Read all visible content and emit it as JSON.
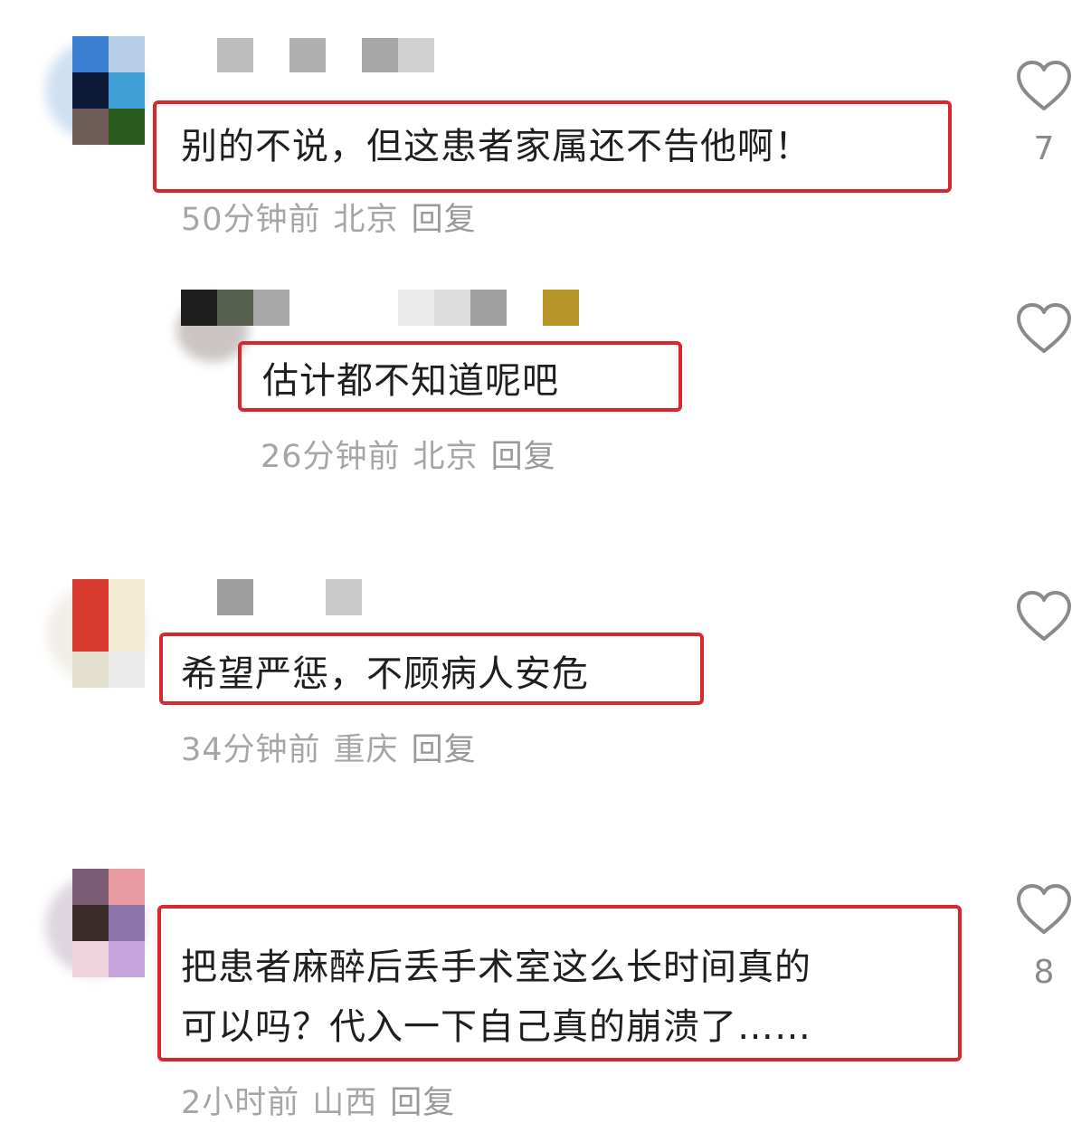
{
  "comments": [
    {
      "text": "别的不说，但这患者家属还不告他啊！",
      "time": "50分钟前",
      "location": "北京",
      "reply_label": "回复",
      "likes": "7",
      "avatar_colors": [
        "#3a7fd0",
        "#b6cfe6",
        "#0c1a36",
        "#3f9fd6",
        "#6e5a57",
        "#2b5a1e"
      ],
      "name_colors": [
        "#bdbdbd",
        "#b0b0b0",
        "#a7a7a7",
        "#d0d0d0"
      ]
    },
    {
      "text": "估计都不知道呢吧",
      "time": "26分钟前",
      "location": "北京",
      "reply_label": "回复",
      "likes": "",
      "avatar_colors": [
        "#1f1f1f",
        "#586050",
        "#a8a8a8"
      ],
      "name_colors": [
        "#ebebeb",
        "#dcdcdc",
        "#a0a0a0",
        "#b89528"
      ]
    },
    {
      "text": "希望严惩，不顾病人安危",
      "time": "34分钟前",
      "location": "重庆",
      "reply_label": "回复",
      "likes": "",
      "avatar_colors": [
        "#d5392f",
        "#f3ead2",
        "#e2dfcd",
        "#ebebeb"
      ],
      "name_colors": [
        "#9e9e9e",
        "#c9c9c9"
      ]
    },
    {
      "text_line1": "把患者麻醉后丢手术室这么长时间真的",
      "text_line2": "可以吗？代入一下自己真的崩溃了……",
      "time": "2小时前",
      "location": "山西",
      "reply_label": "回复",
      "likes": "8",
      "avatar_colors": [
        "#7b5c74",
        "#e79aa2",
        "#3b2a2a",
        "#8b74a8",
        "#f0d3dc",
        "#c6a3da"
      ]
    }
  ],
  "icons": {
    "like": "heart-outline-icon"
  },
  "colors": {
    "highlight": "#d8282c",
    "meta": "#a6a6a6"
  }
}
